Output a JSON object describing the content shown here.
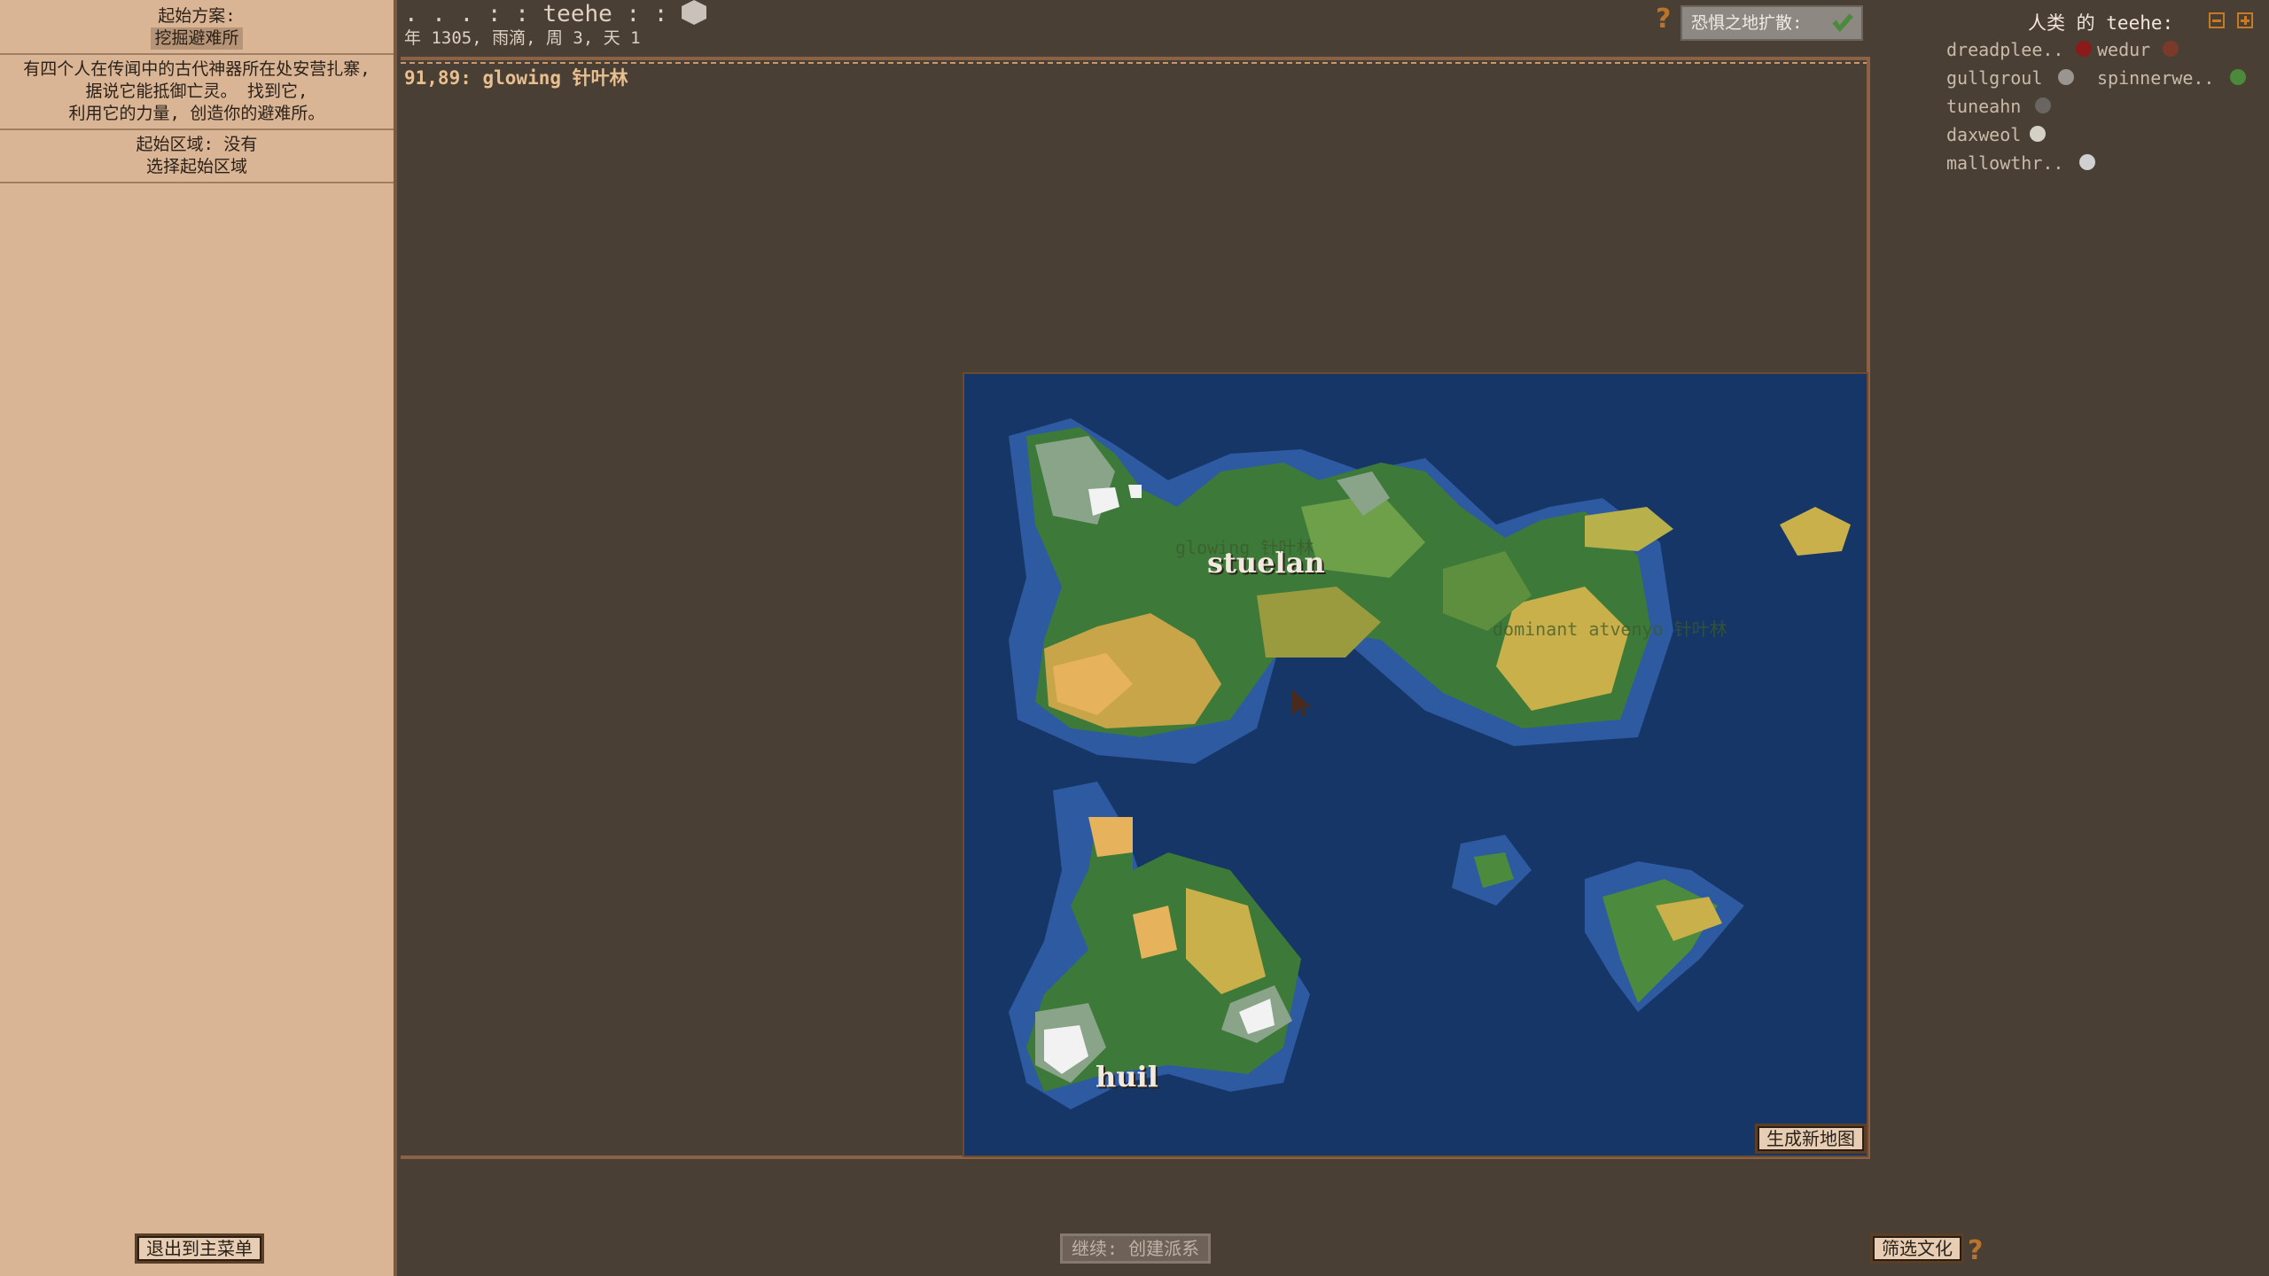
{
  "left_panel": {
    "embark_label": "起始方案:",
    "embark_value": "挖掘避难所",
    "description_lines": [
      "有四个人在传闻中的古代神器所在处安营扎寨,",
      "据说它能抵御亡灵。 找到它,",
      "利用它的力量, 创造你的避难所。"
    ],
    "region_label": "起始区域: 没有",
    "region_hint": "选择起始区域",
    "exit_button": "退出到主菜单"
  },
  "header": {
    "world_title": ". . . : :  teehe  : :",
    "date": "年 1305, 雨滴, 周 3, 天 1",
    "coord_readout": "91,89: glowing 针叶林"
  },
  "evil_toggle": {
    "label": "恐惧之地扩散:",
    "checked": true
  },
  "civ_panel": {
    "title": "人类 的 teehe:",
    "entries": [
      {
        "name": "dreadplee..",
        "icon_color": "#8b1a1a"
      },
      {
        "name": "wedur",
        "icon_color": "#7a3a2a"
      },
      {
        "name": "gullgroul",
        "icon_color": "#9a9590"
      },
      {
        "name": "spinnerwe..",
        "icon_color": "#4b8a3a"
      },
      {
        "name": "tuneahn",
        "icon_color": "#6a6560"
      },
      {
        "name": "daxweol",
        "icon_color": "#d5d0c8"
      },
      {
        "name": "mallowthr..",
        "icon_color": "#d0d0d0"
      }
    ]
  },
  "map": {
    "labels": [
      "stuelan",
      "huil"
    ],
    "faint_labels": [
      "glowing 针叶林",
      "dominant atvenyo 针叶林"
    ],
    "generate_button": "生成新地图"
  },
  "bottom_bar": {
    "continue_button": "继续: 创建派系",
    "culture_button": "筛选文化"
  },
  "colors": {
    "panel": "#d9b596",
    "background": "#4a3f35",
    "ocean": "#153666",
    "accent": "#c67a24"
  }
}
